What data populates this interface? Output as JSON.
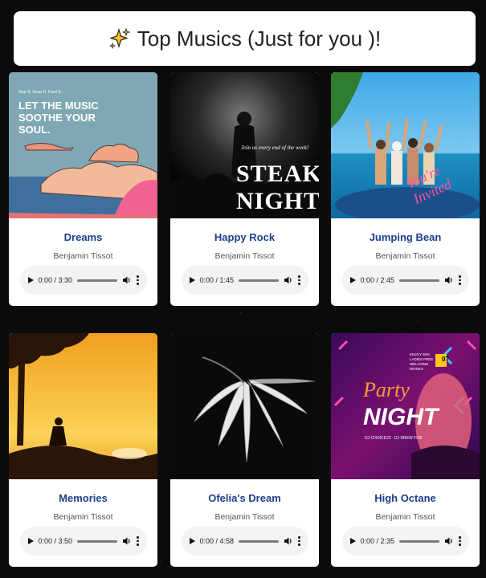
{
  "header": {
    "title": "Top Musics (Just for you )!",
    "icon": "sparkles-icon"
  },
  "art_text": {
    "dreams_small": "See It. Hear It. Feel It.",
    "dreams_big": "LET THE MUSIC SOOTHE YOUR SOUL.",
    "steak_small": "Join us every end of the week!",
    "steak_big_1": "STEAK",
    "steak_big_2": "NIGHT",
    "jumping_script": "You're Invited",
    "party_script": "Party",
    "party_big": "NIGHT",
    "party_badge": "07",
    "party_info": "ENJOY 50% LADIES FREE WELCOME DRINKS",
    "party_djs": "DJ CHOICE22 · DJ DREW FOX"
  },
  "cards": [
    {
      "title": "Dreams",
      "artist": "Benjamin Tissot",
      "time": "0:00 / 3:30"
    },
    {
      "title": "Happy Rock",
      "artist": "Benjamin Tissot",
      "time": "0:00 / 1:45"
    },
    {
      "title": "Jumping Bean",
      "artist": "Benjamin Tissot",
      "time": "0:00 / 2:45"
    },
    {
      "title": "Memories",
      "artist": "Benjamin Tissot",
      "time": "0:00 / 3:50"
    },
    {
      "title": "Ofelia's Dream",
      "artist": "Benjamin Tissot",
      "time": "0:00 / 4:58"
    },
    {
      "title": "High Octane",
      "artist": "Benjamin Tissot",
      "time": "0:00 / 2:35"
    }
  ],
  "colors": {
    "title_blue": "#1d3f8a",
    "page_bg": "#0b0b0b",
    "player_bg": "#f1f3f4"
  }
}
